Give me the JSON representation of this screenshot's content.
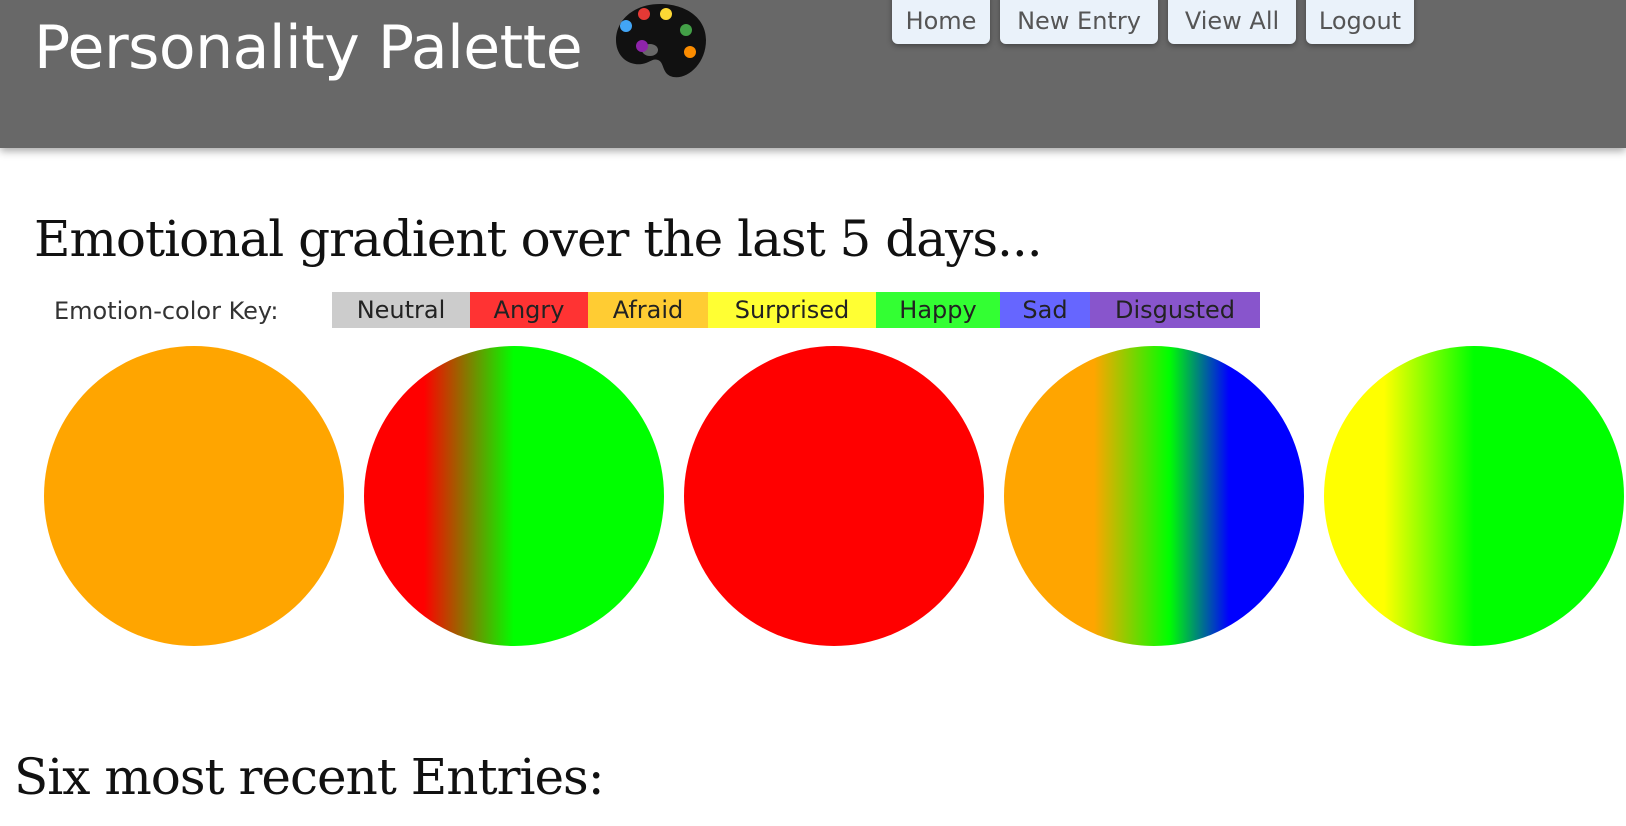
{
  "header": {
    "title": "Personality Palette",
    "logo_icon": "artist-palette-icon",
    "background": "#686868"
  },
  "nav": {
    "items": [
      {
        "label": "Home"
      },
      {
        "label": "New Entry"
      },
      {
        "label": "View All"
      },
      {
        "label": "Logout"
      }
    ]
  },
  "gradient_section": {
    "heading": "Emotional gradient over the last 5 days...",
    "key_label": "Emotion-color Key:",
    "key": [
      {
        "label": "Neutral",
        "color": "#cccccc"
      },
      {
        "label": "Angry",
        "color": "#ff3333"
      },
      {
        "label": "Afraid",
        "color": "#ffcc33"
      },
      {
        "label": "Surprised",
        "color": "#ffff33"
      },
      {
        "label": "Happy",
        "color": "#33ff33"
      },
      {
        "label": "Sad",
        "color": "#6666ff"
      },
      {
        "label": "Disgusted",
        "color": "#8855cc"
      }
    ],
    "days": [
      {
        "colors": [
          "#ffa500"
        ]
      },
      {
        "colors": [
          "#ff0000",
          "#00ff00"
        ]
      },
      {
        "colors": [
          "#ff0000"
        ]
      },
      {
        "colors": [
          "#ffa500",
          "#00ff00",
          "#0000ff"
        ]
      },
      {
        "colors": [
          "#ffff00",
          "#00ff00"
        ]
      }
    ]
  },
  "recent_section": {
    "heading": "Six most recent Entries:"
  }
}
